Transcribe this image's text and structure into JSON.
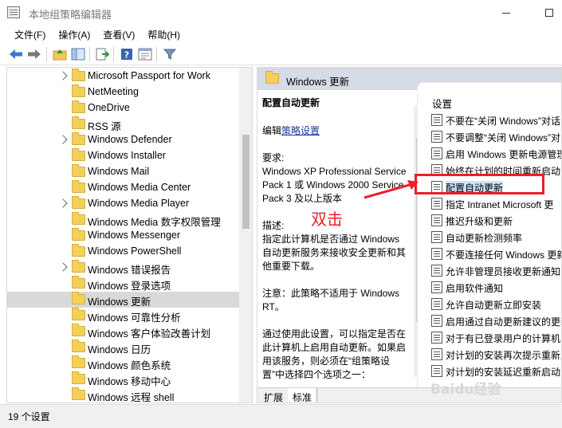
{
  "window": {
    "title": "本地组策略编辑器"
  },
  "menu": [
    "文件(F)",
    "操作(A)",
    "查看(V)",
    "帮助(H)"
  ],
  "toolbar": {
    "icons": [
      "back-icon",
      "forward-icon",
      "up-folder-icon",
      "show-hide-tree-icon",
      "export-list-icon",
      "help-icon",
      "properties-icon",
      "filter-icon"
    ]
  },
  "tree": {
    "items": [
      {
        "label": "Microsoft Passport for Work",
        "expandable": true
      },
      {
        "label": "NetMeeting",
        "expandable": false
      },
      {
        "label": "OneDrive",
        "expandable": false
      },
      {
        "label": "RSS 源",
        "expandable": false
      },
      {
        "label": "Windows Defender",
        "expandable": true
      },
      {
        "label": "Windows Installer",
        "expandable": false
      },
      {
        "label": "Windows Mail",
        "expandable": false
      },
      {
        "label": "Windows Media Center",
        "expandable": false
      },
      {
        "label": "Windows Media Player",
        "expandable": true
      },
      {
        "label": "Windows Media 数字权限管理",
        "expandable": false
      },
      {
        "label": "Windows Messenger",
        "expandable": false
      },
      {
        "label": "Windows PowerShell",
        "expandable": false
      },
      {
        "label": "Windows 错误报告",
        "expandable": true
      },
      {
        "label": "Windows 登录选项",
        "expandable": false
      },
      {
        "label": "Windows 更新",
        "expandable": false,
        "selected": true
      },
      {
        "label": "Windows 可靠性分析",
        "expandable": false
      },
      {
        "label": "Windows 客户体验改善计划",
        "expandable": false
      },
      {
        "label": "Windows 日历",
        "expandable": false
      },
      {
        "label": "Windows 颜色系统",
        "expandable": false
      },
      {
        "label": "Windows 移动中心",
        "expandable": false
      },
      {
        "label": "Windows 远程 shell",
        "expandable": false
      }
    ]
  },
  "right": {
    "header_title": "Windows 更新",
    "desc_title": "配置自动更新",
    "edit_prefix": "编辑",
    "edit_link": "策略设置",
    "requirements_label": "要求:",
    "requirements_text": "Windows XP Professional Service Pack 1 或 Windows 2000 Service Pack 3 及以上版本",
    "description_label": "描述:",
    "description_text": "指定此计算机是否通过 Windows 自动更新服务来接收安全更新和其他重要下载。",
    "note_text": "注意：此策略不适用于 Windows RT。",
    "usage_text": "通过使用此设置，可以指定是否在此计算机上启用自动更新。如果启用该服务，则必须在“组策略设置”中选择四个选项之一：",
    "settings_header": "设置",
    "settings": [
      "不要在“关闭 Windows”对话",
      "不要调整“关闭 Windows”对",
      "启用 Windows 更新电源管理",
      "始终在计划的时间重新启动",
      "配置自动更新",
      "指定 Intranet Microsoft 更",
      "推迟升级和更新",
      "自动更新检测频率",
      "不要连接任何 Windows 更新",
      "允许非管理员接收更新通知",
      "启用软件通知",
      "允许自动更新立即安装",
      "启用通过自动更新建议的更新",
      "对于有已登录用户的计算机",
      "对计划的安装再次提示重新启",
      "对计划的安装延迟重新启动"
    ],
    "tabs": [
      "扩展",
      "标准"
    ]
  },
  "annotation": {
    "text": "双击",
    "color": "#e8202b"
  },
  "status": {
    "text": "19 个设置"
  },
  "watermark": "Baidu经验"
}
